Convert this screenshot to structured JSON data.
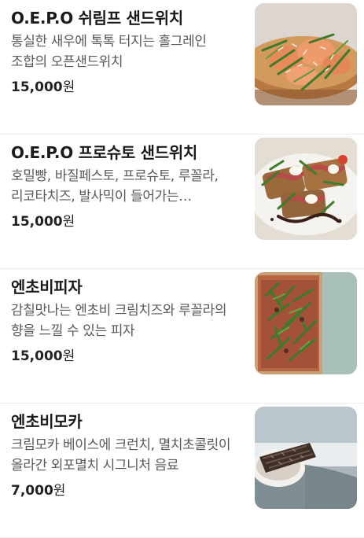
{
  "menu": {
    "items": [
      {
        "name": "O.E.P.O 쉬림프 샌드위치",
        "description": "통실한 새우에 톡톡 터지는 홀그레인 조합의 오픈샌드위치",
        "price": "15,000",
        "currency": "원",
        "image_icon": "shrimp-sandwich-photo"
      },
      {
        "name": "O.E.P.O 프로슈토 샌드위치",
        "description": "호밀빵, 바질페스토, 프로슈토, 루꼴라, 리코타치즈, 발사믹이 들어가는 오픈샌드위치",
        "price": "15,000",
        "currency": "원",
        "image_icon": "prosciutto-sandwich-photo"
      },
      {
        "name": "엔초비피자",
        "description": "감칠맛나는 엔초비 크림치즈와 루꼴라의 향을 느낄 수 있는 피자",
        "price": "15,000",
        "currency": "원",
        "image_icon": "anchovy-pizza-photo"
      },
      {
        "name": "엔초비모카",
        "description": "크림모카 베이스에 크런치, 멸치초콜릿이 올라간 외포멸치 시그니처 음료",
        "price": "7,000",
        "currency": "원",
        "image_icon": "anchovy-mocha-photo"
      }
    ]
  }
}
